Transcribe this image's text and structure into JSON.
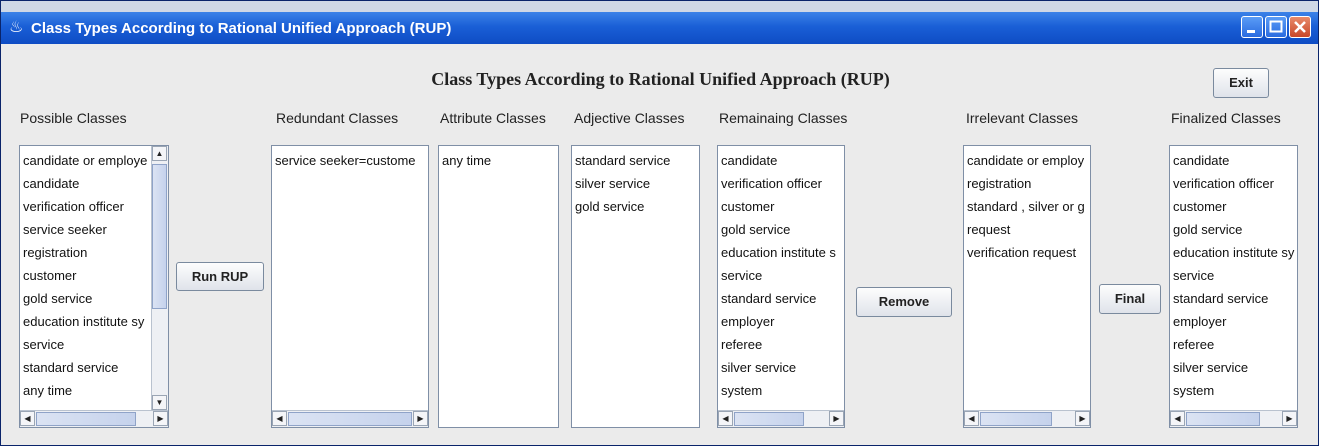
{
  "window": {
    "title": "Class Types According to Rational Unified Approach (RUP)"
  },
  "heading": "Class Types According to Rational Unified Approach (RUP)",
  "buttons": {
    "exit": "Exit",
    "run_rup": "Run RUP",
    "remove": "Remove",
    "final": "Final"
  },
  "lists": {
    "possible": {
      "label": "Possible Classes",
      "items": [
        "candidate or employe",
        "candidate",
        "verification officer",
        "service seeker",
        "registration",
        "customer",
        "gold service",
        "education institute sy",
        "service",
        "standard service",
        "any time"
      ]
    },
    "redundant": {
      "label": "Redundant Classes",
      "items": [
        "service seeker=custome"
      ]
    },
    "attribute": {
      "label": "Attribute Classes",
      "items": [
        "any time"
      ]
    },
    "adjective": {
      "label": "Adjective Classes",
      "items": [
        "standard service",
        "silver service",
        "gold service"
      ]
    },
    "remaining": {
      "label": "Remainaing Classes",
      "items": [
        "candidate",
        "verification officer",
        "customer",
        "gold service",
        "education institute s",
        "service",
        "standard service",
        "employer",
        "referee",
        "silver service",
        "system"
      ]
    },
    "irrelevant": {
      "label": "Irrelevant Classes",
      "items": [
        "candidate or employ",
        "registration",
        "standard , silver or g",
        "request",
        "verification request"
      ]
    },
    "finalized": {
      "label": "Finalized Classes",
      "items": [
        "candidate",
        "verification officer",
        "customer",
        "gold service",
        "education institute sy",
        "service",
        "standard service",
        "employer",
        "referee",
        "silver service",
        "system"
      ]
    }
  },
  "icons": {
    "app": "coffee-cup-icon",
    "minimize": "minimize-icon",
    "maximize": "maximize-icon",
    "close": "close-icon"
  }
}
